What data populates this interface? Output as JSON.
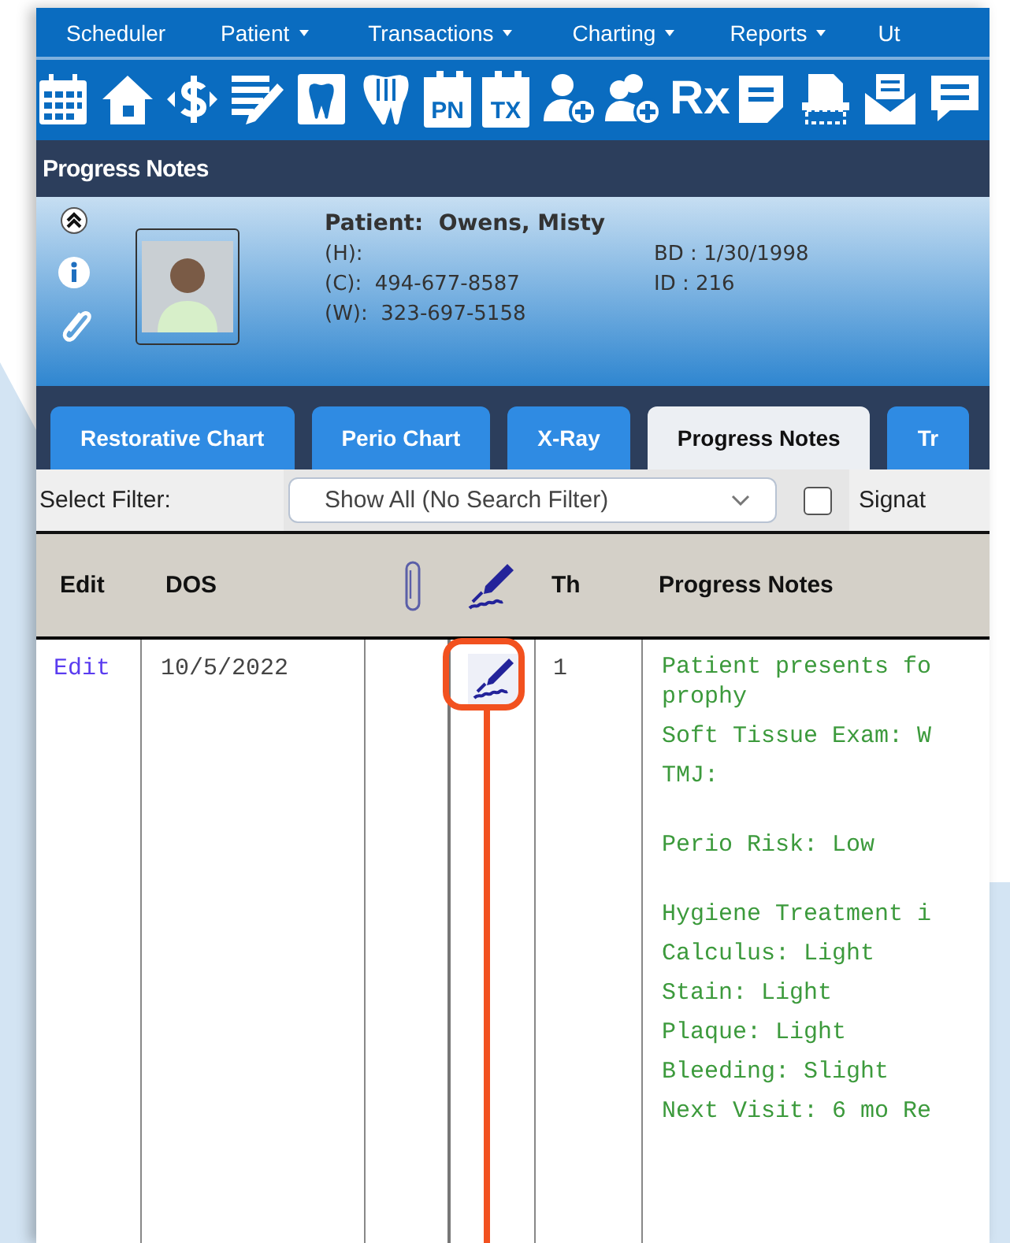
{
  "menu": [
    {
      "label": "Scheduler",
      "dropdown": false
    },
    {
      "label": "Patient",
      "dropdown": true
    },
    {
      "label": "Transactions",
      "dropdown": true
    },
    {
      "label": "Charting",
      "dropdown": true
    },
    {
      "label": "Reports",
      "dropdown": true
    },
    {
      "label": "Ut",
      "dropdown": false
    }
  ],
  "toolbar": [
    {
      "kind": "calendar"
    },
    {
      "kind": "house"
    },
    {
      "kind": "dollar"
    },
    {
      "kind": "notepad"
    },
    {
      "kind": "tooth-chart"
    },
    {
      "kind": "tooth"
    },
    {
      "kind": "tag",
      "label": "PN"
    },
    {
      "kind": "tag",
      "label": "TX"
    },
    {
      "kind": "person-add"
    },
    {
      "kind": "people-add"
    },
    {
      "kind": "rx",
      "label": "Rx"
    },
    {
      "kind": "note"
    },
    {
      "kind": "scan"
    },
    {
      "kind": "mail"
    },
    {
      "kind": "chat"
    }
  ],
  "window": {
    "title": "Progress Notes"
  },
  "patient": {
    "label": "Patient:",
    "name": "Owens, Misty",
    "fields": [
      {
        "label": "(H):"
      },
      {
        "label": "(C):",
        "value": "494-677-8587"
      },
      {
        "label": "(W):",
        "value": "323-697-5158"
      }
    ],
    "info": [
      {
        "label": "BD :",
        "value": "1/30/1998"
      },
      {
        "label": "ID :",
        "value": "216"
      }
    ]
  },
  "tabs": [
    {
      "label": "Restorative Chart",
      "selected": false
    },
    {
      "label": "Perio Chart",
      "selected": false
    },
    {
      "label": "X-Ray",
      "selected": false
    },
    {
      "label": "Progress Notes",
      "selected": true
    },
    {
      "label": "Tr",
      "selected": false
    }
  ],
  "filter": {
    "label": "Select Filter:",
    "value": "Show All (No Search Filter)",
    "checked": false,
    "checkbox_label": "Signat"
  },
  "table": {
    "columns": [
      {
        "kind": "text",
        "label": "Edit"
      },
      {
        "kind": "text",
        "label": "DOS"
      },
      {
        "kind": "clip"
      },
      {
        "kind": "sign"
      },
      {
        "kind": "text",
        "label": "Th"
      },
      {
        "kind": "text",
        "label": "Progress Notes"
      }
    ],
    "rows": [
      {
        "edit": "Edit",
        "dos": "10/5/2022",
        "signed": true,
        "th": "1",
        "note_sections": [
          {
            "entries": [
              {
                "lines": [
                  "Patient presents fo",
                  "prophy"
                ]
              },
              {
                "lines": [
                  "Soft Tissue Exam: W"
                ]
              },
              {
                "lines": [
                  "TMJ:"
                ]
              }
            ]
          },
          {
            "entries": [
              {
                "lines": [
                  "Perio Risk: Low"
                ]
              }
            ]
          },
          {
            "entries": [
              {
                "lines": [
                  "Hygiene Treatment i"
                ]
              },
              {
                "lines": [
                  "Calculus: Light"
                ]
              },
              {
                "lines": [
                  "Stain: Light"
                ]
              },
              {
                "lines": [
                  "Plaque: Light"
                ]
              },
              {
                "lines": [
                  "Bleeding: Slight"
                ]
              },
              {
                "lines": [
                  "Next Visit: 6 mo Re"
                ]
              }
            ]
          }
        ]
      }
    ]
  }
}
